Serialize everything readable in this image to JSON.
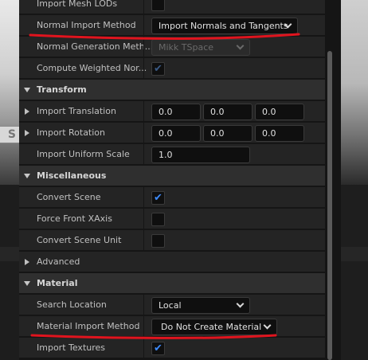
{
  "background": {
    "viewport_text": "S"
  },
  "rows": {
    "import_mesh_lods": {
      "label": "Import Mesh LODs",
      "checked": false
    },
    "normal_import_method": {
      "label": "Normal Import Method",
      "value": "Import Normals and Tangents"
    },
    "normal_generation_method": {
      "label": "Normal Generation Meth...",
      "value": "Mikk TSpace",
      "disabled": true
    },
    "compute_weighted_normals": {
      "label": "Compute Weighted Nor...",
      "checked": true,
      "disabled": true
    }
  },
  "transform": {
    "header": "Transform",
    "import_translation": {
      "label": "Import Translation",
      "x": "0.0",
      "y": "0.0",
      "z": "0.0"
    },
    "import_rotation": {
      "label": "Import Rotation",
      "x": "0.0",
      "y": "0.0",
      "z": "0.0"
    },
    "import_uniform_scale": {
      "label": "Import Uniform Scale",
      "value": "1.0"
    }
  },
  "miscellaneous": {
    "header": "Miscellaneous",
    "convert_scene": {
      "label": "Convert Scene",
      "checked": true
    },
    "force_front_xaxis": {
      "label": "Force Front XAxis",
      "checked": false
    },
    "convert_scene_unit": {
      "label": "Convert Scene Unit",
      "checked": false
    },
    "advanced": {
      "label": "Advanced"
    }
  },
  "material": {
    "header": "Material",
    "search_location": {
      "label": "Search Location",
      "value": "Local"
    },
    "material_import_method": {
      "label": "Material Import Method",
      "value": "Do Not Create Material"
    },
    "import_textures": {
      "label": "Import Textures",
      "checked": true
    }
  },
  "colors": {
    "annotation_red": "#e0141e",
    "checkmark_blue": "#3d8bfd",
    "row_bg": "#242424",
    "section_bg": "#2f2f2f"
  },
  "icons": {
    "check": "check-icon",
    "chevron": "chevron-down-icon",
    "expand_arrow": "expand-arrow-icon",
    "collapse_arrow": "collapse-arrow-icon"
  }
}
